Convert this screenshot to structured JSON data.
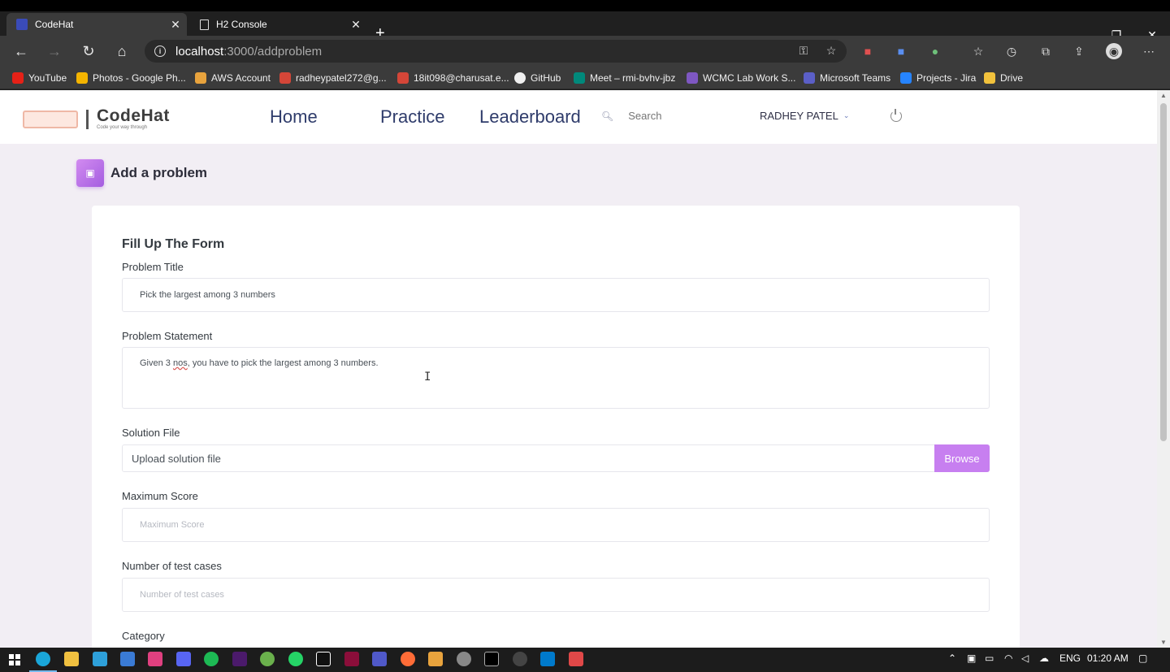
{
  "browser": {
    "tabs": [
      {
        "title": "CodeHat",
        "active": true
      },
      {
        "title": "H2 Console",
        "active": false
      }
    ],
    "url_host": "localhost",
    "url_path": ":3000/addproblem",
    "bookmarks": [
      "YouTube",
      "Photos - Google Ph...",
      "AWS Account",
      "radheypatel272@g...",
      "18it098@charusat.e...",
      "GitHub",
      "Meet – rmi-bvhv-jbz",
      "WCMC Lab Work S...",
      "Microsoft Teams",
      "Projects - Jira",
      "Drive"
    ]
  },
  "app": {
    "brand": "CodeHat",
    "tagline": "Code your way through",
    "nav": {
      "home": "Home",
      "practice": "Practice",
      "leaderboard": "Leaderboard"
    },
    "search_placeholder": "Search",
    "user_name": "RADHEY PATEL",
    "accent_color": "#c77ff0",
    "nav_text_color": "#2f3c6b"
  },
  "page": {
    "heading": "Add a problem",
    "form_title": "Fill Up The Form",
    "fields": {
      "title_label": "Problem Title",
      "title_value": "Pick the largest among 3 numbers",
      "statement_label": "Problem Statement",
      "statement_pre": "Given 3 ",
      "statement_misspelled": "nos",
      "statement_post": ", you have to pick the largest among 3 numbers.",
      "solution_label": "Solution File",
      "solution_placeholder": "Upload solution file",
      "browse_label": "Browse",
      "maxscore_label": "Maximum Score",
      "maxscore_placeholder": "Maximum Score",
      "testcases_label": "Number of test cases",
      "testcases_placeholder": "Number of test cases",
      "category_label": "Category"
    }
  },
  "taskbar": {
    "language": "ENG",
    "time": "01:20 AM"
  }
}
